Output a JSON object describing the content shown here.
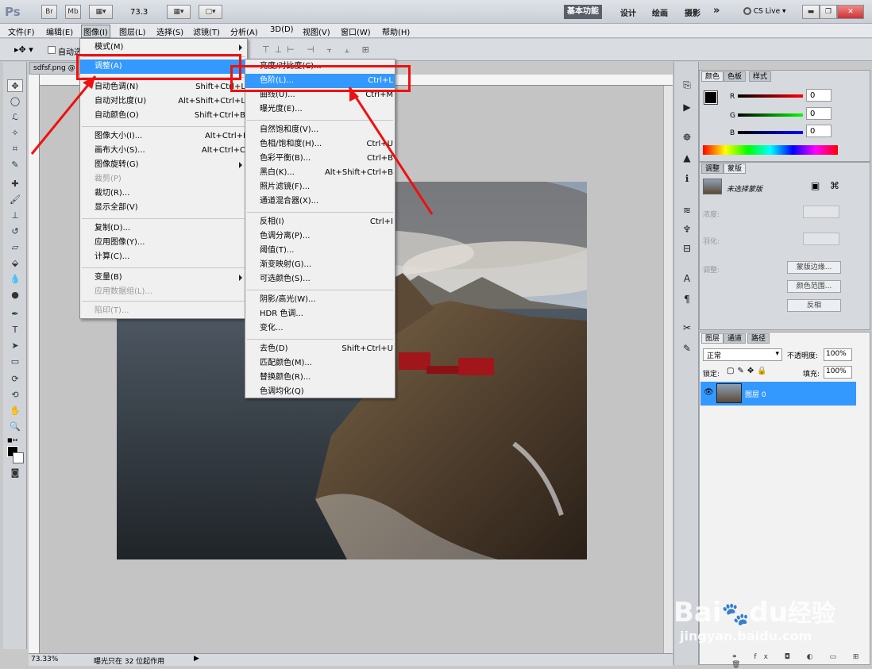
{
  "app": {
    "logo": "Ps",
    "zoom": "73.3"
  },
  "titlebar": {
    "bridge_btn": "Br",
    "minibridge_btn": "Mb",
    "workspaces": [
      "基本功能",
      "设计",
      "绘画",
      "摄影"
    ],
    "more": "»",
    "cslive": "CS Live"
  },
  "menubar": [
    "文件(F)",
    "编辑(E)",
    "图像(I)",
    "图层(L)",
    "选择(S)",
    "滤镜(T)",
    "分析(A)",
    "3D(D)",
    "视图(V)",
    "窗口(W)",
    "帮助(H)"
  ],
  "options": {
    "auto_select": "自动选"
  },
  "document": {
    "tab": "sdfsf.png @",
    "status_zoom": "73.33%",
    "status_text": "曝光只在 32 位起作用"
  },
  "image_menu": {
    "items": [
      {
        "label": "模式(M)",
        "shortcut": "",
        "submenu": true
      },
      {
        "label": "调整(A)",
        "shortcut": "",
        "submenu": true,
        "highlight": true
      },
      {
        "label": "自动色调(N)",
        "shortcut": "Shift+Ctrl+L"
      },
      {
        "label": "自动对比度(U)",
        "shortcut": "Alt+Shift+Ctrl+L"
      },
      {
        "label": "自动颜色(O)",
        "shortcut": "Shift+Ctrl+B"
      },
      {
        "label": "图像大小(I)...",
        "shortcut": "Alt+Ctrl+I"
      },
      {
        "label": "画布大小(S)...",
        "shortcut": "Alt+Ctrl+C"
      },
      {
        "label": "图像旋转(G)",
        "shortcut": "",
        "submenu": true
      },
      {
        "label": "裁剪(P)",
        "shortcut": "",
        "disabled": true
      },
      {
        "label": "裁切(R)...",
        "shortcut": ""
      },
      {
        "label": "显示全部(V)",
        "shortcut": ""
      },
      {
        "label": "复制(D)...",
        "shortcut": ""
      },
      {
        "label": "应用图像(Y)...",
        "shortcut": ""
      },
      {
        "label": "计算(C)...",
        "shortcut": ""
      },
      {
        "label": "变量(B)",
        "shortcut": "",
        "submenu": true
      },
      {
        "label": "应用数据组(L)...",
        "shortcut": "",
        "disabled": true
      },
      {
        "label": "陷印(T)...",
        "shortcut": "",
        "disabled": true
      }
    ]
  },
  "adjust_menu": {
    "items": [
      {
        "label": "亮度/对比度(C)...",
        "shortcut": ""
      },
      {
        "label": "色阶(L)...",
        "shortcut": "Ctrl+L",
        "highlight": true
      },
      {
        "label": "曲线(U)...",
        "shortcut": "Ctrl+M"
      },
      {
        "label": "曝光度(E)...",
        "shortcut": ""
      },
      {
        "label": "自然饱和度(V)...",
        "shortcut": ""
      },
      {
        "label": "色相/饱和度(H)...",
        "shortcut": "Ctrl+U"
      },
      {
        "label": "色彩平衡(B)...",
        "shortcut": "Ctrl+B"
      },
      {
        "label": "黑白(K)...",
        "shortcut": "Alt+Shift+Ctrl+B"
      },
      {
        "label": "照片滤镜(F)...",
        "shortcut": ""
      },
      {
        "label": "通道混合器(X)...",
        "shortcut": ""
      },
      {
        "label": "反相(I)",
        "shortcut": "Ctrl+I"
      },
      {
        "label": "色调分离(P)...",
        "shortcut": ""
      },
      {
        "label": "阈值(T)...",
        "shortcut": ""
      },
      {
        "label": "渐变映射(G)...",
        "shortcut": ""
      },
      {
        "label": "可选颜色(S)...",
        "shortcut": ""
      },
      {
        "label": "阴影/高光(W)...",
        "shortcut": ""
      },
      {
        "label": "HDR 色调...",
        "shortcut": ""
      },
      {
        "label": "变化...",
        "shortcut": ""
      },
      {
        "label": "去色(D)",
        "shortcut": "Shift+Ctrl+U"
      },
      {
        "label": "匹配颜色(M)...",
        "shortcut": ""
      },
      {
        "label": "替换颜色(R)...",
        "shortcut": ""
      },
      {
        "label": "色调均化(Q)",
        "shortcut": ""
      }
    ]
  },
  "color_panel": {
    "tabs": [
      "颜色",
      "色板",
      "样式"
    ],
    "r_label": "R",
    "g_label": "G",
    "b_label": "B",
    "r": "0",
    "g": "0",
    "b": "0"
  },
  "masks_panel": {
    "tabs": [
      "调整",
      "蒙版"
    ],
    "no_mask": "未选择蒙版",
    "density_label": "浓度:",
    "feather_label": "羽化:",
    "refine_label": "调整:",
    "btn_edge": "蒙版边缘...",
    "btn_range": "颜色范围...",
    "btn_invert": "反相"
  },
  "layers_panel": {
    "tabs": [
      "图层",
      "通道",
      "路径"
    ],
    "blend": "正常",
    "opacity_label": "不透明度:",
    "opacity": "100%",
    "lock_label": "锁定:",
    "fill_label": "填充:",
    "fill": "100%",
    "layer_name": "图层 0"
  },
  "watermark": {
    "brand_a": "Bai",
    "brand_b": "du",
    "brand_c": "经验",
    "url": "jingyan.baidu.com"
  },
  "colors": {
    "accent": "#3399ff",
    "annotation": "#ee1111",
    "selected_layer": "#3399ff"
  }
}
